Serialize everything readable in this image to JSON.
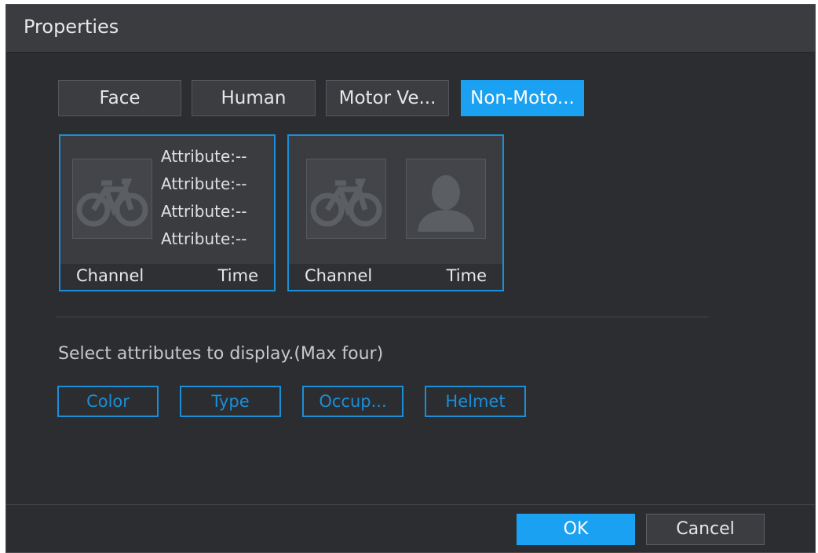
{
  "dialog": {
    "title": "Properties"
  },
  "tabs": [
    {
      "label": "Face",
      "active": false
    },
    {
      "label": "Human",
      "active": false
    },
    {
      "label": "Motor Ve...",
      "active": false
    },
    {
      "label": "Non-Moto...",
      "active": true
    }
  ],
  "preview_cards": [
    {
      "attributes": [
        "Attribute:--",
        "Attribute:--",
        "Attribute:--",
        "Attribute:--"
      ],
      "channel_label": "Channel",
      "time_label": "Time",
      "thumbnails": [
        "bicycle-icon"
      ]
    },
    {
      "channel_label": "Channel",
      "time_label": "Time",
      "thumbnails": [
        "bicycle-icon",
        "person-silhouette-icon"
      ]
    }
  ],
  "attribute_selection": {
    "prompt": "Select attributes to display.(Max four)",
    "options": [
      "Color",
      "Type",
      "Occup...",
      "Helmet"
    ]
  },
  "footer": {
    "ok_label": "OK",
    "cancel_label": "Cancel"
  },
  "colors": {
    "accent": "#1aa1f2",
    "background": "#2b2d31",
    "title_bar": "#3a3c40"
  }
}
